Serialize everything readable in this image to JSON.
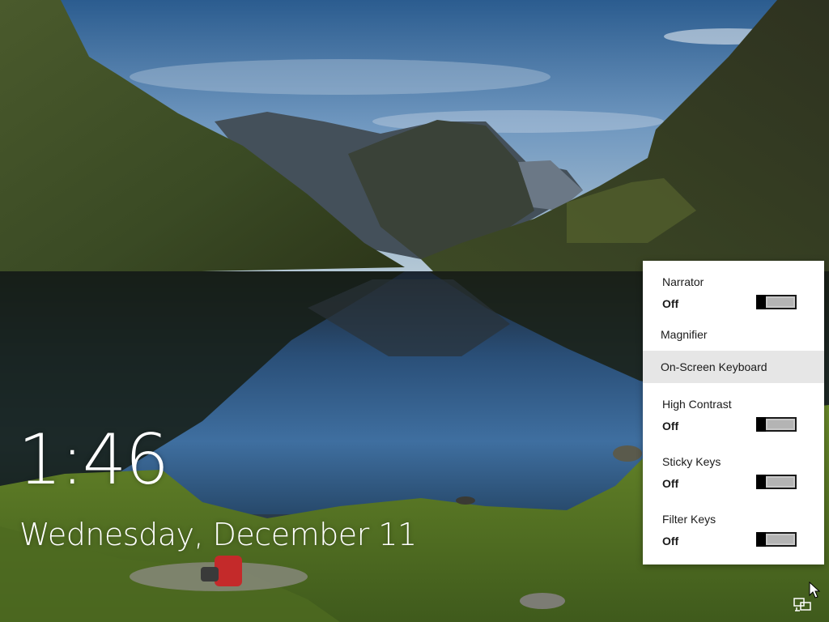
{
  "lockscreen": {
    "time": "1:46",
    "date": "Wednesday, December 11"
  },
  "ease_of_access": {
    "narrator": {
      "label": "Narrator",
      "state": "Off"
    },
    "magnifier": {
      "label": "Magnifier"
    },
    "on_screen_keyboard": {
      "label": "On-Screen Keyboard"
    },
    "high_contrast": {
      "label": "High Contrast",
      "state": "Off"
    },
    "sticky_keys": {
      "label": "Sticky Keys",
      "state": "Off"
    },
    "filter_keys": {
      "label": "Filter Keys",
      "state": "Off"
    }
  },
  "tray": {
    "icon": "ease-of-access-icon"
  },
  "colors": {
    "panel_bg": "#ffffff",
    "hover_bg": "#e6e6e6",
    "toggle_off": "#c8c8c8",
    "clock_text": "#ffffff"
  }
}
